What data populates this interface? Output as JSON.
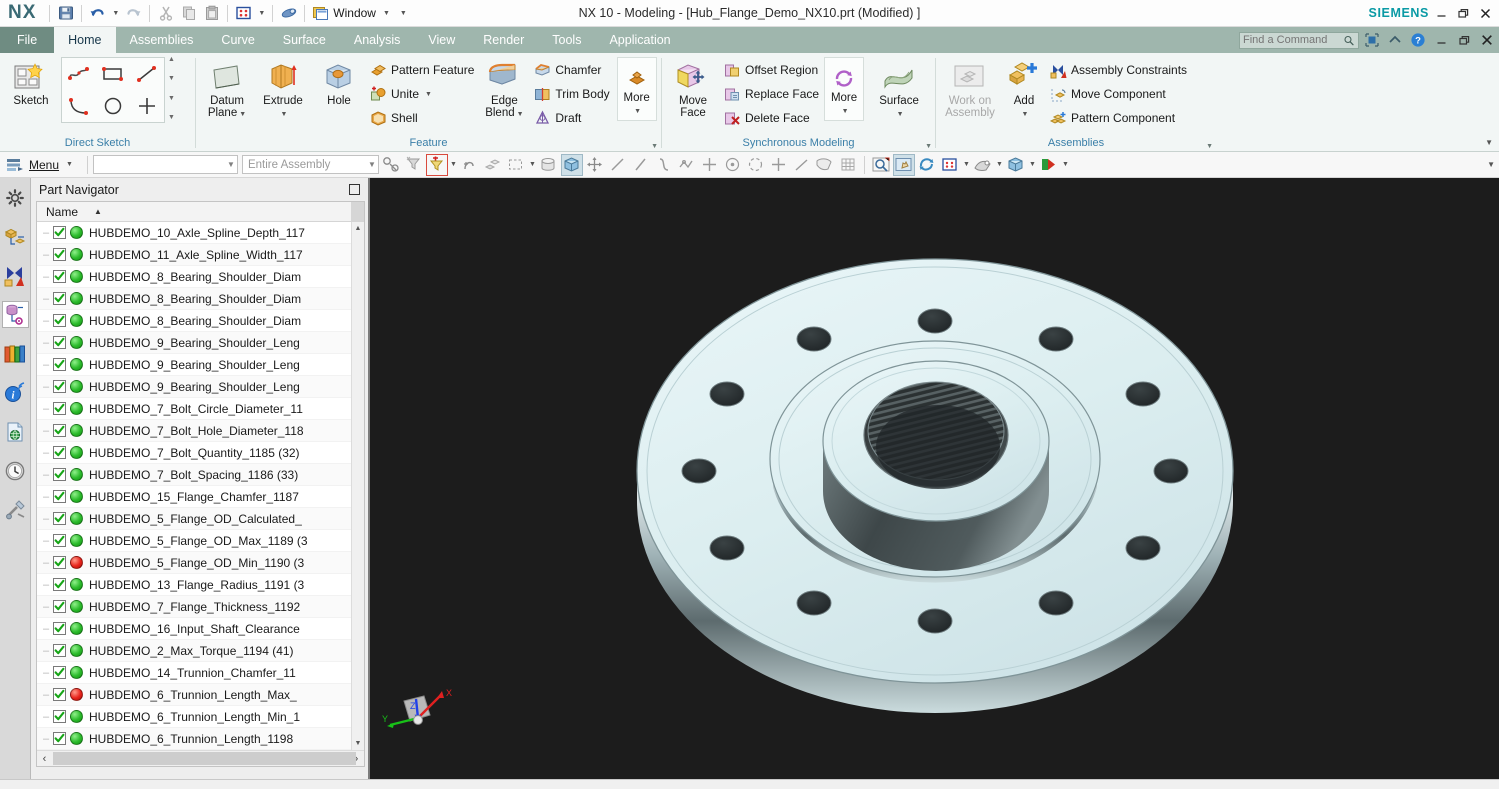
{
  "titlebar": {
    "logo": "NX",
    "title": "NX 10 - Modeling - [Hub_Flange_Demo_NX10.prt (Modified) ]",
    "brand": "SIEMENS",
    "quick_access": [
      {
        "name": "save-icon",
        "label": "Save"
      },
      {
        "name": "undo-icon",
        "label": "Undo"
      },
      {
        "name": "redo-icon",
        "label": "Redo"
      },
      {
        "name": "cut-icon",
        "label": "Cut"
      },
      {
        "name": "copy-icon",
        "label": "Copy"
      },
      {
        "name": "paste-icon",
        "label": "Paste"
      },
      {
        "name": "layout-icon",
        "label": "Layout"
      },
      {
        "name": "eraser-icon",
        "label": "Erase"
      },
      {
        "name": "window-icon",
        "label": "Window"
      }
    ],
    "window_menu_label": "Window",
    "window_controls": [
      "minimize",
      "restore",
      "close"
    ]
  },
  "tabs": [
    {
      "label": "File",
      "active": false,
      "file": true
    },
    {
      "label": "Home",
      "active": true,
      "file": false
    },
    {
      "label": "Assemblies",
      "active": false,
      "file": false
    },
    {
      "label": "Curve",
      "active": false,
      "file": false
    },
    {
      "label": "Surface",
      "active": false,
      "file": false
    },
    {
      "label": "Analysis",
      "active": false,
      "file": false
    },
    {
      "label": "Render",
      "active": false,
      "file": false
    },
    {
      "label": "Tools",
      "active": false,
      "file": false
    },
    {
      "label": "View",
      "active": false,
      "file": false
    },
    {
      "label": "Application",
      "active": false,
      "file": false
    }
  ],
  "tab_order": [
    "File",
    "Home",
    "Assemblies",
    "Curve",
    "Surface",
    "Analysis",
    "View",
    "Render",
    "Tools",
    "Application"
  ],
  "search": {
    "placeholder": "Find a Command",
    "value": "",
    "icon": "search-icon"
  },
  "ribbon": {
    "groups": [
      {
        "caption": "Direct Sketch",
        "sketch_button": "Sketch",
        "tools": [
          "profile-icon",
          "rectangle-icon",
          "line-icon",
          "arc-icon",
          "circle-icon",
          "point-icon"
        ]
      },
      {
        "caption": "Feature",
        "big_buttons": [
          {
            "label1": "Datum",
            "label2": "Plane",
            "has_caret": true,
            "name": "datum-plane-button"
          },
          {
            "label1": "Extrude",
            "label2": "",
            "has_caret": true,
            "name": "extrude-button"
          },
          {
            "label1": "Hole",
            "label2": "",
            "has_caret": false,
            "name": "hole-button"
          }
        ],
        "small_col1": [
          {
            "label": "Pattern Feature",
            "icon": "pattern-feature-icon",
            "caret": false
          },
          {
            "label": "Unite",
            "icon": "unite-icon",
            "caret": true
          },
          {
            "label": "Shell",
            "icon": "shell-icon",
            "caret": false
          }
        ],
        "edge_blend": {
          "label1": "Edge",
          "label2": "Blend",
          "caret": true
        },
        "small_col2": [
          {
            "label": "Chamfer",
            "icon": "chamfer-icon",
            "caret": false
          },
          {
            "label": "Trim Body",
            "icon": "trim-body-icon",
            "caret": false
          },
          {
            "label": "Draft",
            "icon": "draft-icon",
            "caret": false
          }
        ],
        "more": {
          "label": "More",
          "caret": true
        }
      },
      {
        "caption": "Synchronous Modeling",
        "move_face": {
          "label1": "Move",
          "label2": "Face"
        },
        "small_col": [
          {
            "label": "Offset Region",
            "icon": "offset-region-icon"
          },
          {
            "label": "Replace Face",
            "icon": "replace-face-icon"
          },
          {
            "label": "Delete Face",
            "icon": "delete-face-icon"
          }
        ],
        "more": {
          "label": "More",
          "caret": true
        },
        "surface": {
          "label": "Surface",
          "caret": true
        }
      },
      {
        "caption": "Assemblies",
        "work_on_assembly": {
          "label1": "Work on",
          "label2": "Assembly",
          "disabled": true
        },
        "add": {
          "label": "Add",
          "caret": true
        },
        "small_col": [
          {
            "label": "Assembly Constraints",
            "icon": "assembly-constraints-icon"
          },
          {
            "label": "Move Component",
            "icon": "move-component-icon"
          },
          {
            "label": "Pattern Component",
            "icon": "pattern-component-icon"
          }
        ]
      }
    ]
  },
  "toolbar": {
    "menu_label": "Menu",
    "menu_icon": "menu-icon",
    "type_filter": {
      "value": "",
      "placeholder": ""
    },
    "scope_filter": {
      "value": "Entire Assembly"
    },
    "icons": [
      {
        "name": "select-objects-icon",
        "selected": false
      },
      {
        "name": "general-filter-icon",
        "selected": false
      },
      {
        "name": "snap-filter-icon",
        "selected": false,
        "highlight": "red"
      },
      {
        "name": "snap-point-icon",
        "selected": false
      },
      {
        "name": "feature-group-icon",
        "selected": false
      },
      {
        "name": "rectangle-select-icon",
        "selected": false
      },
      {
        "name": "render-style-icon",
        "selected": false
      },
      {
        "name": "shaded-with-edges-icon",
        "selected": true
      },
      {
        "name": "move-object-icon",
        "selected": false
      },
      {
        "name": "line-icon",
        "selected": false
      },
      {
        "name": "datum-line-icon",
        "selected": false
      },
      {
        "name": "spline-icon",
        "selected": false
      },
      {
        "name": "polyline-icon",
        "selected": false
      },
      {
        "name": "plus-snap-icon",
        "selected": false
      },
      {
        "name": "center-point-icon",
        "selected": false
      },
      {
        "name": "quadrant-point-icon",
        "selected": false
      },
      {
        "name": "intersection-icon",
        "selected": false
      },
      {
        "name": "tangent-icon",
        "selected": false
      },
      {
        "name": "face-select-icon",
        "selected": false
      },
      {
        "name": "grid-icon",
        "selected": false
      },
      {
        "name": "zoom-fit-icon",
        "selected": false
      },
      {
        "name": "pan-icon",
        "selected": true
      },
      {
        "name": "rotate-icon",
        "selected": false
      },
      {
        "name": "layout-icon",
        "selected": false
      },
      {
        "name": "perspective-icon",
        "selected": false
      },
      {
        "name": "orientation-cube-icon",
        "selected": false
      },
      {
        "name": "section-icon",
        "selected": false
      }
    ]
  },
  "resource_bar": {
    "items": [
      {
        "name": "settings-icon",
        "label": "Customize",
        "selected": false
      },
      {
        "name": "assembly-navigator-icon",
        "label": "Assembly Navigator",
        "selected": false
      },
      {
        "name": "constraint-navigator-icon",
        "label": "Constraint Navigator",
        "selected": false
      },
      {
        "name": "part-navigator-icon",
        "label": "Part Navigator",
        "selected": true
      },
      {
        "name": "reuse-library-icon",
        "label": "Reuse Library",
        "selected": false
      },
      {
        "name": "hd3d-tools-icon",
        "label": "HD3D Tools",
        "selected": false
      },
      {
        "name": "web-browser-icon",
        "label": "Web Browser",
        "selected": false
      },
      {
        "name": "history-icon",
        "label": "History",
        "selected": false
      },
      {
        "name": "process-studio-icon",
        "label": "Process Studio",
        "selected": false
      }
    ]
  },
  "part_navigator": {
    "title": "Part Navigator",
    "maximize_icon": "maximize-icon",
    "column_header": "Name",
    "sort_indicator": "▲",
    "rows": [
      {
        "label": "HUBDEMO_10_Axle_Spline_Depth_117",
        "checked": true,
        "status": "green"
      },
      {
        "label": "HUBDEMO_11_Axle_Spline_Width_117",
        "checked": true,
        "status": "green"
      },
      {
        "label": "HUBDEMO_8_Bearing_Shoulder_Diam",
        "checked": true,
        "status": "green"
      },
      {
        "label": "HUBDEMO_8_Bearing_Shoulder_Diam",
        "checked": true,
        "status": "green"
      },
      {
        "label": "HUBDEMO_8_Bearing_Shoulder_Diam",
        "checked": true,
        "status": "green"
      },
      {
        "label": "HUBDEMO_9_Bearing_Shoulder_Leng",
        "checked": true,
        "status": "green"
      },
      {
        "label": "HUBDEMO_9_Bearing_Shoulder_Leng",
        "checked": true,
        "status": "green"
      },
      {
        "label": "HUBDEMO_9_Bearing_Shoulder_Leng",
        "checked": true,
        "status": "green"
      },
      {
        "label": "HUBDEMO_7_Bolt_Circle_Diameter_11",
        "checked": true,
        "status": "green"
      },
      {
        "label": "HUBDEMO_7_Bolt_Hole_Diameter_118",
        "checked": true,
        "status": "green"
      },
      {
        "label": "HUBDEMO_7_Bolt_Quantity_1185 (32)",
        "checked": true,
        "status": "green"
      },
      {
        "label": "HUBDEMO_7_Bolt_Spacing_1186 (33)",
        "checked": true,
        "status": "green"
      },
      {
        "label": "HUBDEMO_15_Flange_Chamfer_1187",
        "checked": true,
        "status": "green"
      },
      {
        "label": "HUBDEMO_5_Flange_OD_Calculated_",
        "checked": true,
        "status": "green"
      },
      {
        "label": "HUBDEMO_5_Flange_OD_Max_1189 (3",
        "checked": true,
        "status": "green"
      },
      {
        "label": "HUBDEMO_5_Flange_OD_Min_1190 (3",
        "checked": true,
        "status": "red"
      },
      {
        "label": "HUBDEMO_13_Flange_Radius_1191 (3",
        "checked": true,
        "status": "green"
      },
      {
        "label": "HUBDEMO_7_Flange_Thickness_1192",
        "checked": true,
        "status": "green"
      },
      {
        "label": "HUBDEMO_16_Input_Shaft_Clearance",
        "checked": true,
        "status": "green"
      },
      {
        "label": "HUBDEMO_2_Max_Torque_1194 (41)",
        "checked": true,
        "status": "green"
      },
      {
        "label": "HUBDEMO_14_Trunnion_Chamfer_11",
        "checked": true,
        "status": "green"
      },
      {
        "label": "HUBDEMO_6_Trunnion_Length_Max_",
        "checked": true,
        "status": "red"
      },
      {
        "label": "HUBDEMO_6_Trunnion_Length_Min_1",
        "checked": true,
        "status": "green"
      },
      {
        "label": "HUBDEMO_6_Trunnion_Length_1198",
        "checked": true,
        "status": "green"
      }
    ],
    "scrollbar": {
      "left_arrow": "‹",
      "right_arrow": "›"
    }
  },
  "viewport": {
    "background": "#1c1c1c",
    "part_color": "#dceef0",
    "bore_color": "#3a3f40",
    "triad": {
      "x_label": "X",
      "x_color": "#e02020",
      "y_label": "Y",
      "y_color": "#18c018",
      "z_label": "Z",
      "z_color": "#2040e8"
    },
    "model": {
      "name": "Hub_Flange_Demo_NX10",
      "bolt_hole_count": 12
    }
  }
}
